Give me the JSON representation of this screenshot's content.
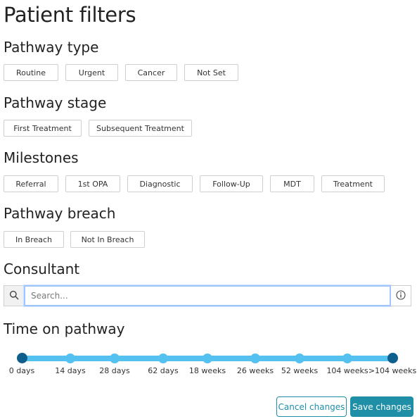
{
  "page": {
    "title": "Patient filters"
  },
  "pathway_type": {
    "title": "Pathway type",
    "options": [
      "Routine",
      "Urgent",
      "Cancer",
      "Not Set"
    ]
  },
  "pathway_stage": {
    "title": "Pathway stage",
    "options": [
      "First Treatment",
      "Subsequent Treatment"
    ]
  },
  "milestones": {
    "title": "Milestones",
    "options": [
      "Referral",
      "1st OPA",
      "Diagnostic",
      "Follow-Up",
      "MDT",
      "Treatment"
    ]
  },
  "pathway_breach": {
    "title": "Pathway breach",
    "options": [
      "In Breach",
      "Not In Breach"
    ]
  },
  "consultant": {
    "title": "Consultant",
    "search_placeholder": "Search...",
    "search_value": "",
    "search_icon": "search-icon",
    "info_icon": "info-icon"
  },
  "time_on_pathway": {
    "title": "Time on pathway",
    "ticks": [
      "0 days",
      "14 days",
      "28 days",
      "62 days",
      "18 weeks",
      "26 weeks",
      "52 weeks",
      "104 weeks",
      ">104 weeks"
    ],
    "selected_range": [
      "0 days",
      ">104 weeks"
    ],
    "track_color": "#55c1f0",
    "handle_color": "#0f5f8d"
  },
  "actions": {
    "cancel_label": "Cancel changes",
    "save_label": "Save changes",
    "accent_color": "#1e8fa7"
  }
}
